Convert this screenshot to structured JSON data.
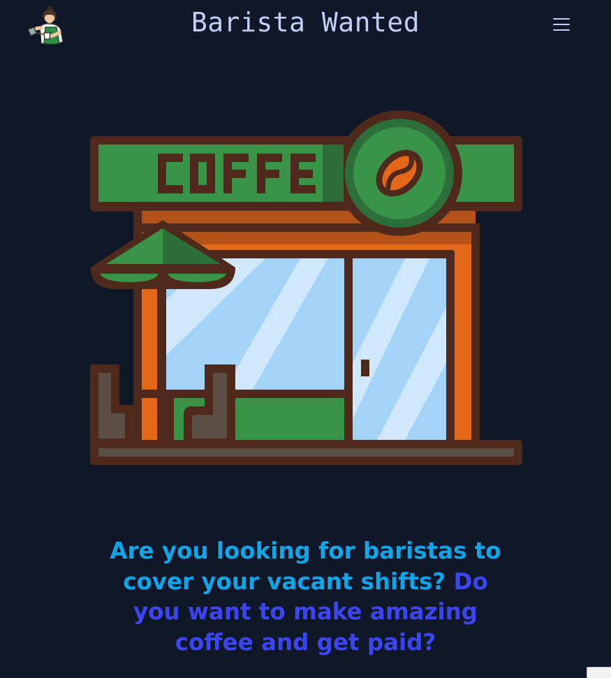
{
  "header": {
    "title": "Barista Wanted",
    "logo_icon": "barista-logo-icon",
    "menu_icon": "hamburger-menu-icon"
  },
  "hero": {
    "storefront_sign": "COFFE",
    "illustration": "coffee-shop-storefront-illustration"
  },
  "headline": {
    "part1": "Are you looking for baristas to cover your vacant shifts?",
    "part2": "Do you want to make amazing coffee and get paid?"
  },
  "colors": {
    "background": "#101729",
    "title": "#c3cff4",
    "headline_primary": "#0ea5e9",
    "headline_secondary": "#3b46f0"
  }
}
